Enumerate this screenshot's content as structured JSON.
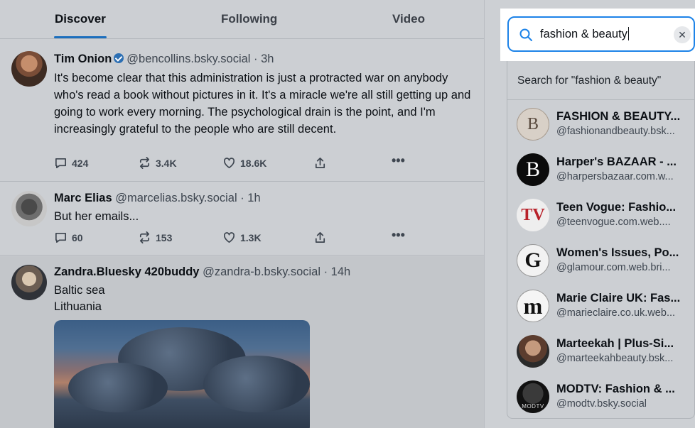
{
  "tabs": [
    {
      "label": "Discover",
      "active": true
    },
    {
      "label": "Following",
      "active": false
    },
    {
      "label": "Video",
      "active": false
    }
  ],
  "posts": [
    {
      "author": "Tim Onion",
      "verified": true,
      "handle": "@bencollins.bsky.social · 3h",
      "text": "It's become clear that this administration is just a protracted war on anybody who's read a book without pictures in it. It's a miracle we're all still getting up and going to work every morning. The psychological drain is the point, and I'm increasingly grateful to the people who are still decent.",
      "replies": "424",
      "reposts": "3.4K",
      "likes": "18.6K"
    },
    {
      "author": "Marc Elias",
      "verified": false,
      "handle": "@marcelias.bsky.social · 1h",
      "text": "But her emails...",
      "replies": "60",
      "reposts": "153",
      "likes": "1.3K"
    },
    {
      "author": "Zandra.Bluesky 420buddy",
      "verified": false,
      "handle": "@zandra-b.bsky.social · 14h",
      "line1": "Baltic sea",
      "line2": "Lithuania"
    }
  ],
  "search": {
    "query": "fashion & beauty",
    "search_for": "Search for \"fashion & beauty\""
  },
  "results": [
    {
      "name": "FASHION & BEAUTY...",
      "handle": "@fashionandbeauty.bsk...",
      "logo": "B"
    },
    {
      "name": "Harper's BAZAAR - ...",
      "handle": "@harpersbazaar.com.w...",
      "logo": "B"
    },
    {
      "name": "Teen Vogue: Fashio...",
      "handle": "@teenvogue.com.web....",
      "logo": "TV"
    },
    {
      "name": "Women's Issues, Po...",
      "handle": "@glamour.com.web.bri...",
      "logo": "G"
    },
    {
      "name": "Marie Claire UK: Fas...",
      "handle": "@marieclaire.co.uk.web...",
      "logo": "m"
    },
    {
      "name": "Marteekah | Plus-Si...",
      "handle": "@marteekahbeauty.bsk...",
      "logo": ""
    },
    {
      "name": "MODTV: Fashion & ...",
      "handle": "@modtv.bsky.social",
      "logo": "MODTV"
    }
  ],
  "colors": {
    "accent": "#1d83e8",
    "tab_underline": "#1c6fbd",
    "verified_badge": "#2c6fb3"
  }
}
